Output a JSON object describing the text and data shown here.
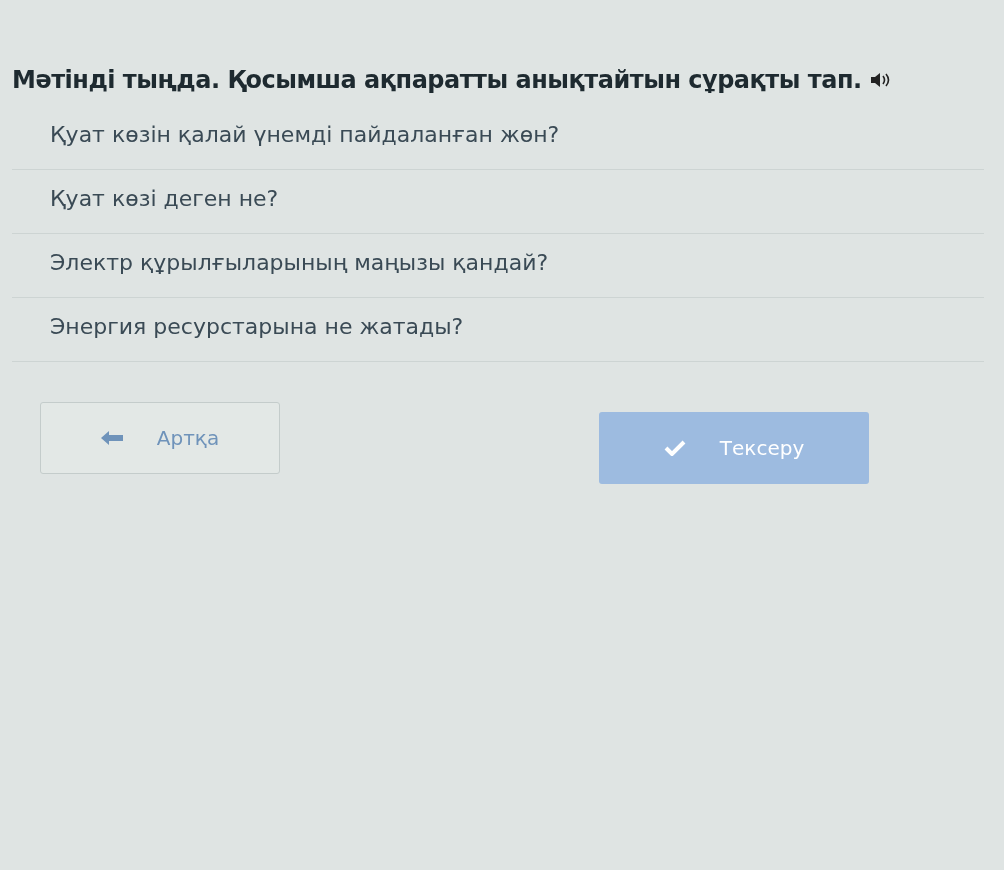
{
  "question": {
    "title": "Мәтінді тыңда. Қосымша ақпаратты анықтайтын сұрақты тап."
  },
  "options": [
    {
      "text": "Қуат көзін қалай үнемді пайдаланған жөн?",
      "selected": false
    },
    {
      "text": "Қуат көзі деген не?",
      "selected": false
    },
    {
      "text": "Электр құрылғыларының маңызы қандай?",
      "selected": false
    },
    {
      "text": "Энергия ресурстарына не жатады?",
      "selected": false
    }
  ],
  "buttons": [
    {
      "kind": "back",
      "label": "Артқа",
      "disabled": true
    },
    {
      "kind": "check",
      "label": "Тексеру",
      "disabled": true
    }
  ]
}
